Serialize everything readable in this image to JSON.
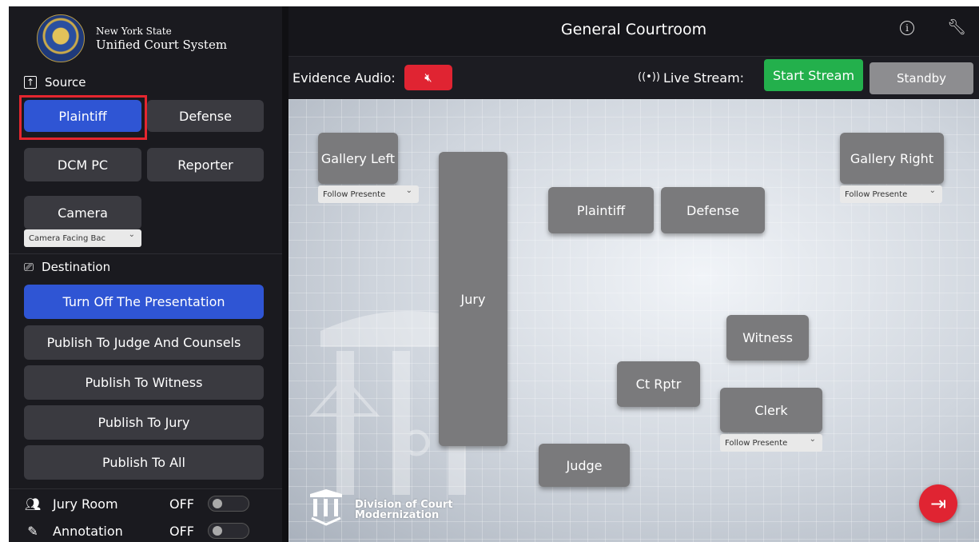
{
  "org": {
    "line1": "New York State",
    "line2": "Unified Court System"
  },
  "source": {
    "heading": "Source",
    "buttons": [
      "Plaintiff",
      "Defense",
      "DCM PC",
      "Reporter",
      "Camera"
    ],
    "camera_select": "Camera Facing Bac"
  },
  "destination": {
    "heading": "Destination",
    "buttons": [
      "Turn Off The Presentation",
      "Publish To Judge And Counsels",
      "Publish To Witness",
      "Publish To Jury",
      "Publish To All"
    ]
  },
  "toggles": [
    {
      "label": "Jury Room",
      "state": "OFF",
      "icon": "people-icon"
    },
    {
      "label": "Annotation",
      "state": "OFF",
      "icon": "pencil-icon"
    }
  ],
  "header": {
    "title": "General Courtroom"
  },
  "audio_bar": {
    "evidence_label": "Evidence Audio:",
    "live_label": "Live Stream:",
    "start_label": "Start Stream",
    "standby_label": "Standby"
  },
  "courtroom": {
    "gallery_left": "Gallery Left",
    "gallery_right": "Gallery Right",
    "jury": "Jury",
    "plaintiff": "Plaintiff",
    "defense": "Defense",
    "witness": "Witness",
    "ct_rptr": "Ct Rptr",
    "clerk": "Clerk",
    "judge": "Judge",
    "follow_select": "Follow Presente"
  },
  "footer": {
    "dcm_line1": "Division of Court",
    "dcm_line2": "Modernization"
  },
  "colors": {
    "accent_blue": "#2f55d4",
    "danger_red": "#e02432",
    "stream_green": "#23b04c",
    "seat_gray": "#7a7a7c"
  }
}
